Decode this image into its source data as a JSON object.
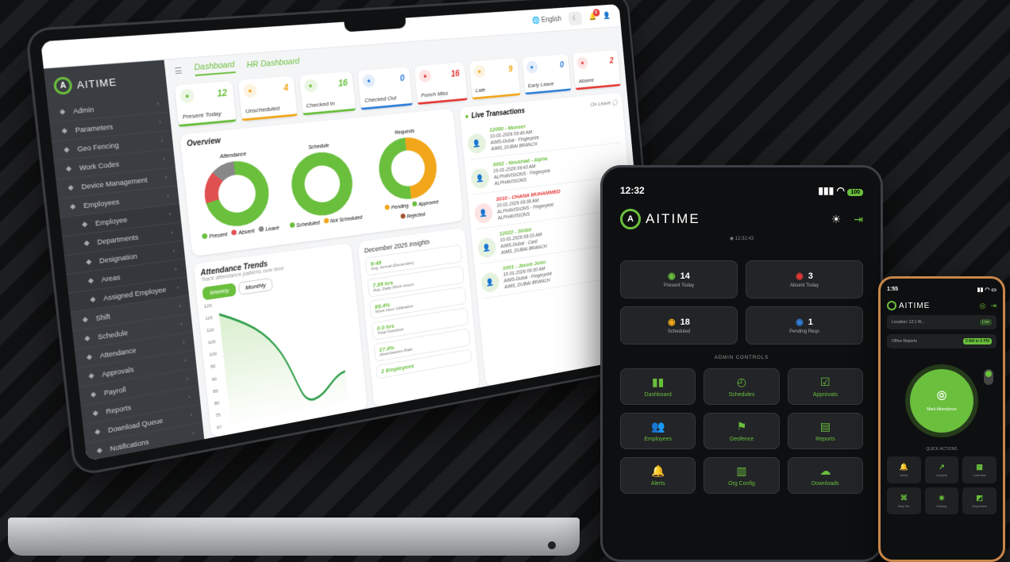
{
  "laptop": {
    "topbar": {
      "language": "English",
      "notification_count": "0"
    },
    "brand": {
      "logo_text": "AITIME"
    },
    "tabs": {
      "dashboard": "Dashboard",
      "hr_dashboard": "HR Dashboard"
    },
    "sidebar": [
      {
        "label": "Admin",
        "icon": "admin-icon",
        "sub": false
      },
      {
        "label": "Parameters",
        "icon": "gear-icon",
        "sub": false
      },
      {
        "label": "Geo Fencing",
        "icon": "pin-icon",
        "sub": false
      },
      {
        "label": "Work Codes",
        "icon": "code-icon",
        "sub": false
      },
      {
        "label": "Device Management",
        "icon": "device-icon",
        "sub": false
      },
      {
        "label": "Employees",
        "icon": "users-icon",
        "sub": false
      },
      {
        "label": "Employee",
        "icon": "user-icon",
        "sub": true
      },
      {
        "label": "Departments",
        "icon": "dept-icon",
        "sub": true
      },
      {
        "label": "Designation",
        "icon": "badge-icon",
        "sub": true
      },
      {
        "label": "Areas",
        "icon": "area-icon",
        "sub": true
      },
      {
        "label": "Assigned Employee",
        "icon": "assign-icon",
        "sub": true
      },
      {
        "label": "Shift",
        "icon": "clock-icon",
        "sub": false
      },
      {
        "label": "Schedule",
        "icon": "calendar-icon",
        "sub": false
      },
      {
        "label": "Attendance",
        "icon": "check-icon",
        "sub": false
      },
      {
        "label": "Approvals",
        "icon": "approve-icon",
        "sub": false
      },
      {
        "label": "Payroll",
        "icon": "money-icon",
        "sub": false
      },
      {
        "label": "Reports",
        "icon": "report-icon",
        "sub": false
      },
      {
        "label": "Download Queue",
        "icon": "download-icon",
        "sub": false
      },
      {
        "label": "Notifications",
        "icon": "bell-icon",
        "sub": false
      },
      {
        "label": "Configurations",
        "icon": "config-icon",
        "sub": false
      }
    ],
    "stats": [
      {
        "label": "Present Today",
        "value": "12",
        "color": "#6abf3d"
      },
      {
        "label": "Unscheduled",
        "value": "4",
        "color": "#f2a71b"
      },
      {
        "label": "Checked In",
        "value": "16",
        "color": "#6abf3d"
      },
      {
        "label": "Checked Out",
        "value": "0",
        "color": "#2f7fd8"
      },
      {
        "label": "Punch Miss",
        "value": "16",
        "color": "#e53935"
      },
      {
        "label": "Late",
        "value": "9",
        "color": "#f2a71b"
      },
      {
        "label": "Early Leave",
        "value": "0",
        "color": "#2f7fd8"
      },
      {
        "label": "Absent",
        "value": "2",
        "color": "#e53935"
      }
    ],
    "overview": {
      "title": "Overview",
      "attendance": {
        "title": "Attendance",
        "legend": [
          "Present",
          "Absent",
          "Leave"
        ]
      },
      "schedule": {
        "title": "Schedule",
        "legend": [
          "Scheduled",
          "Not Scheduled"
        ]
      },
      "requests": {
        "title": "Requests",
        "legend": [
          "Pending",
          "Approved",
          "Rejected"
        ]
      }
    },
    "trends": {
      "title": "Attendance Trends",
      "subtitle": "Track attendance patterns over time",
      "toggle_weekly": "Weekly",
      "toggle_monthly": "Monthly",
      "yticks": [
        "120",
        "115",
        "110",
        "105",
        "100",
        "95",
        "90",
        "85",
        "80",
        "75",
        "67"
      ]
    },
    "insights": {
      "title": "December 2025 Insights",
      "items": [
        {
          "value": "9:49",
          "label": "Avg. Arrival (December)"
        },
        {
          "value": "7.85 hrs",
          "label": "Avg. Daily Work Hours"
        },
        {
          "value": "89.4%",
          "label": "Work Hour Utilization"
        },
        {
          "value": "0.0 hrs",
          "label": "Total Overtime"
        },
        {
          "value": "17.4%",
          "label": "Absenteeism Rate"
        },
        {
          "value": "2 Employees",
          "label": ""
        }
      ]
    },
    "live": {
      "title": "Live Transactions",
      "on_leave": "On Leave",
      "items": [
        {
          "name": "12080 - Muneer",
          "time": "10-01-2026 09:46 AM",
          "device": "AIMS-Dubai",
          "method": "Fingerprint",
          "branch": "AIMS_DUBAI BRANCH",
          "tag": "",
          "alert": false
        },
        {
          "name": "3002 - Noushad - Alpha",
          "time": "10-01-2026 09:43 AM",
          "device": "ALPHAVISIONS",
          "method": "Fingerprint",
          "branch": "ALPHAVISIONS",
          "tag": "",
          "alert": false
        },
        {
          "name": "3010 - CHANA MUHAMMED",
          "time": "10-01-2026 09:38 AM",
          "device": "ALPHAVISIONS",
          "method": "Fingerprint",
          "branch": "ALPHAVISIONS",
          "tag": "OUT",
          "alert": true
        },
        {
          "name": "12022 - Shibil",
          "time": "10-01-2026 09:33 AM",
          "device": "AIMS-Dubai",
          "method": "Card",
          "branch": "AIMS_DUBAI BRANCH",
          "tag": "IN",
          "alert": false
        },
        {
          "name": "1001 - Jacob John",
          "time": "10-01-2026 09:30 AM",
          "device": "AIMS-Dubai",
          "method": "Fingerprint",
          "branch": "AIMS_DUBAI BRANCH",
          "tag": "IN",
          "alert": false
        }
      ]
    }
  },
  "tablet": {
    "time": "12:32",
    "battery": "100",
    "logo_text": "AITIME",
    "clock": "12:32:43",
    "stats": [
      {
        "value": "14",
        "label": "Present Today",
        "icon": "users-icon"
      },
      {
        "value": "3",
        "label": "Absent Today",
        "icon": "user-x-icon"
      },
      {
        "value": "18",
        "label": "Scheduled",
        "icon": "calendar-icon"
      },
      {
        "value": "1",
        "label": "Pending Reqs",
        "icon": "doc-icon"
      }
    ],
    "section": "ADMIN CONTROLS",
    "tiles": [
      {
        "label": "Dashboard",
        "icon": "bar-chart-icon",
        "glyph": "▮▮"
      },
      {
        "label": "Schedules",
        "icon": "clock-icon",
        "glyph": "◴"
      },
      {
        "label": "Approvals",
        "icon": "approval-icon",
        "glyph": "☑"
      },
      {
        "label": "Employees",
        "icon": "users-icon",
        "glyph": "👥"
      },
      {
        "label": "Geofence",
        "icon": "walk-icon",
        "glyph": "⚑"
      },
      {
        "label": "Reports",
        "icon": "report-icon",
        "glyph": "▤"
      },
      {
        "label": "Alerts",
        "icon": "bell-icon",
        "glyph": "🔔"
      },
      {
        "label": "Org Config",
        "icon": "org-icon",
        "glyph": "▥"
      },
      {
        "label": "Downloads",
        "icon": "cloud-icon",
        "glyph": "☁"
      }
    ]
  },
  "phone": {
    "time": "1:55",
    "logo_text": "AITIME",
    "row1": "Location: 12:1 W...",
    "row1_chip": "Live",
    "row2": "Office Reports",
    "row2_shift": "9 AM to 6 PM",
    "mark_label": "Mark Attendance",
    "quick_title": "QUICK ACTIONS",
    "tiles": [
      {
        "label": "Alerts",
        "glyph": "🔔"
      },
      {
        "label": "Insights",
        "glyph": "↗"
      },
      {
        "label": "Calendar",
        "glyph": "▦"
      },
      {
        "label": "Map Me",
        "glyph": "⌘"
      },
      {
        "label": "Holiday",
        "glyph": "⎈"
      },
      {
        "label": "Regularize",
        "glyph": "◩"
      }
    ]
  },
  "colors": {
    "accent": "#6abf3d",
    "danger": "#e53935",
    "warning": "#f2a71b",
    "info": "#2f7fd8"
  }
}
